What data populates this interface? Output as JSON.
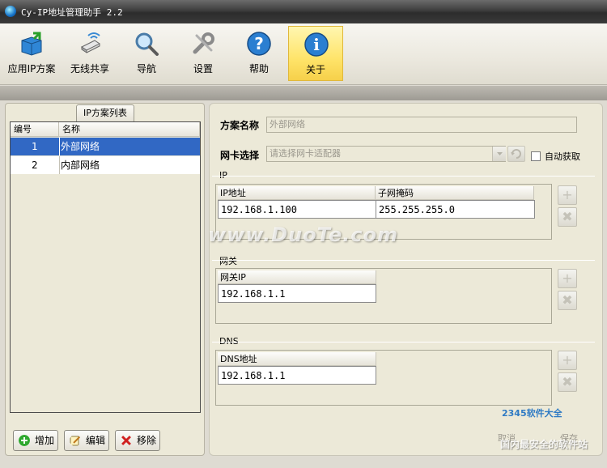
{
  "window": {
    "title": "Cy-IP地址管理助手 2.2"
  },
  "toolbar": {
    "items": [
      {
        "label": "应用IP方案",
        "icon": "apply-scheme-icon"
      },
      {
        "label": "无线共享",
        "icon": "wireless-share-icon"
      },
      {
        "label": "导航",
        "icon": "magnifier-icon"
      },
      {
        "label": "设置",
        "icon": "wrench-icon"
      },
      {
        "label": "帮助",
        "icon": "help-icon"
      },
      {
        "label": "关于",
        "icon": "info-icon",
        "active": true
      }
    ]
  },
  "scheme_list": {
    "tab_label": "IP方案列表",
    "columns": [
      "编号",
      "名称"
    ],
    "rows": [
      {
        "id": "1",
        "name": "外部网络",
        "selected": true
      },
      {
        "id": "2",
        "name": "内部网络",
        "selected": false
      }
    ],
    "buttons": {
      "add": "增加",
      "edit": "编辑",
      "remove": "移除"
    }
  },
  "detail": {
    "scheme_name_label": "方案名称",
    "scheme_name_value": "外部网络",
    "nic_label": "网卡选择",
    "nic_placeholder": "请选择网卡适配器",
    "auto_get_label": "自动获取",
    "ip_section": {
      "title": "IP",
      "columns": [
        "IP地址",
        "子网掩码"
      ],
      "ip": "192.168.1.100",
      "mask": "255.255.255.0"
    },
    "gateway_section": {
      "title": "网关",
      "column": "网关IP",
      "value": "192.168.1.1"
    },
    "dns_section": {
      "title": "DNS",
      "column": "DNS地址",
      "value": "192.168.1.1"
    },
    "cancel_label": "取消",
    "save_label": "保存"
  },
  "watermark": {
    "text": "www.DuoTe.com",
    "logo": "2345软件大全",
    "sub": "国内最安全的软件站"
  },
  "colors": {
    "selection": "#3168c4",
    "active_tab": "#ffe46a",
    "titlebar": "#3d3d3d"
  }
}
